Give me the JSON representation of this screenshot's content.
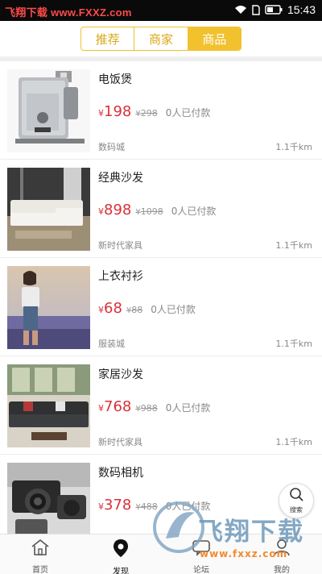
{
  "status_bar": {
    "watermark": "飞翔下载 www.FXXZ.com",
    "time": "15:43",
    "icons": [
      "wifi-icon",
      "sim-icon",
      "battery-icon"
    ]
  },
  "tabs": [
    {
      "label": "推荐",
      "active": false
    },
    {
      "label": "商家",
      "active": false
    },
    {
      "label": "商品",
      "active": true
    }
  ],
  "products": [
    {
      "name": "电饭煲",
      "yen": "¥",
      "price": "198",
      "old_yen": "¥",
      "old_price": "298",
      "paid": "0人已付款",
      "shop": "数码城",
      "distance": "1.1千km"
    },
    {
      "name": "经典沙发",
      "yen": "¥",
      "price": "898",
      "old_yen": "¥",
      "old_price": "1098",
      "paid": "0人已付款",
      "shop": "新时代家具",
      "distance": "1.1千km"
    },
    {
      "name": "上衣衬衫",
      "yen": "¥",
      "price": "68",
      "old_yen": "¥",
      "old_price": "88",
      "paid": "0人已付款",
      "shop": "服装城",
      "distance": "1.1千km"
    },
    {
      "name": "家居沙发",
      "yen": "¥",
      "price": "768",
      "old_yen": "¥",
      "old_price": "988",
      "paid": "0人已付款",
      "shop": "新时代家具",
      "distance": "1.1千km"
    },
    {
      "name": "数码相机",
      "yen": "¥",
      "price": "378",
      "old_yen": "¥",
      "old_price": "488",
      "paid": "0人已付款",
      "shop": "",
      "distance": ""
    }
  ],
  "fab": {
    "label": "搜索",
    "icon": "search-icon"
  },
  "bottom_nav": [
    {
      "label": "首页",
      "icon": "home-icon",
      "active": false
    },
    {
      "label": "发现",
      "icon": "location-pin-icon",
      "active": true
    },
    {
      "label": "论坛",
      "icon": "forum-icon",
      "active": false
    },
    {
      "label": "我的",
      "icon": "profile-icon",
      "active": false
    }
  ],
  "watermark_bottom": {
    "title": "飞翔下载",
    "url": "www.fxxz.com"
  },
  "colors": {
    "accent": "#f2c12e",
    "price": "#d8323a",
    "status_bar": "#0a0a0a"
  }
}
